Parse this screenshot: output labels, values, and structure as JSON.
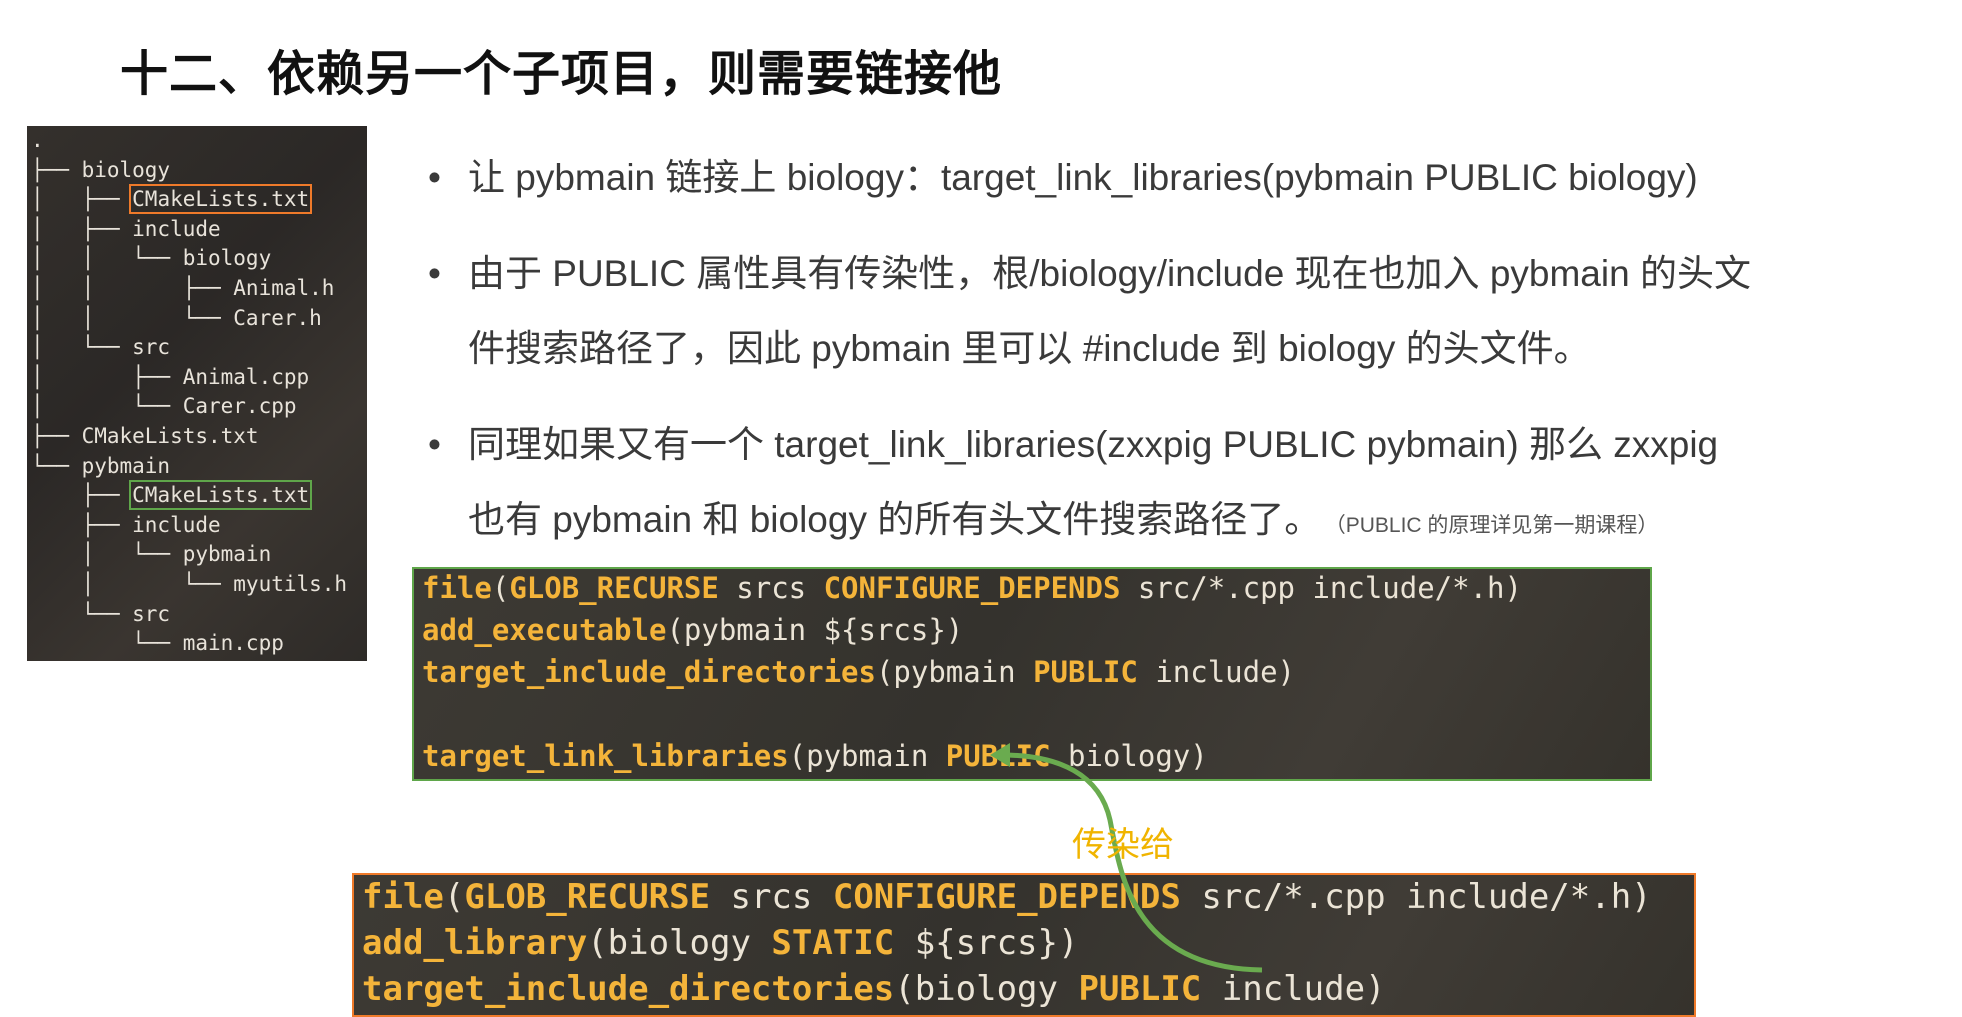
{
  "title": "十二、依赖另一个子项目，则需要链接他",
  "tree": {
    "lines": [
      ".",
      "├── biology",
      "│   ├── CMakeLists.txt",
      "│   ├── include",
      "│   │   └── biology",
      "│   │       ├── Animal.h",
      "│   │       └── Carer.h",
      "│   └── src",
      "│       ├── Animal.cpp",
      "│       └── Carer.cpp",
      "├── CMakeLists.txt",
      "└── pybmain",
      "    ├── CMakeLists.txt",
      "    ├── include",
      "    │   └── pybmain",
      "    │       └── myutils.h",
      "    └── src",
      "        └── main.cpp"
    ],
    "highlight_orange": "CMakeLists.txt",
    "highlight_green": "CMakeLists.txt"
  },
  "bullets": [
    {
      "line1": "让 pybmain 链接上 biology：target_link_libraries(pybmain PUBLIC biology)"
    },
    {
      "line1": "由于 PUBLIC 属性具有传染性，根/biology/include 现在也加入 pybmain 的头文",
      "line2": "件搜索路径了，因此 pybmain 里可以 #include 到 biology 的头文件。"
    },
    {
      "line1": "同理如果又有一个 target_link_libraries(zxxpig PUBLIC pybmain) 那么 zxxpig",
      "line2": "也有 pybmain 和 biology 的所有头文件搜索路径了。",
      "note": "（PUBLIC 的原理详见第一期课程）"
    }
  ],
  "bullet_symbol": "•",
  "code_pybmain": {
    "l1_fn": "file",
    "l1_a": "(",
    "l1_k1": "GLOB_RECURSE",
    "l1_b": " srcs ",
    "l1_k2": "CONFIGURE_DEPENDS",
    "l1_c": " src/*.cpp include/*.h)",
    "l2_fn": "add_executable",
    "l2_a": "(pybmain ${srcs})",
    "l3_fn": "target_include_directories",
    "l3_a": "(pybmain ",
    "l3_k": "PUBLIC",
    "l3_b": " include)",
    "l5_fn": "target_link_libraries",
    "l5_a": "(pybmain ",
    "l5_k": "PUBLIC",
    "l5_b": " biology)"
  },
  "code_biology": {
    "l1_fn": "file",
    "l1_a": "(",
    "l1_k1": "GLOB_RECURSE",
    "l1_b": " srcs ",
    "l1_k2": "CONFIGURE_DEPENDS",
    "l1_c": " src/*.cpp include/*.h)",
    "l2_fn": "add_library",
    "l2_a": "(biology ",
    "l2_k": "STATIC",
    "l2_b": " ${srcs})",
    "l3_fn": "target_include_directories",
    "l3_a": "(biology ",
    "l3_k": "PUBLIC",
    "l3_b": " include)"
  },
  "spread_label": "传染给",
  "colors": {
    "keyword": "#f4b43a",
    "green_box": "#5fa64a",
    "orange_box": "#ef7a2a",
    "arrow": "#6aab4f",
    "label": "#f0b400"
  }
}
